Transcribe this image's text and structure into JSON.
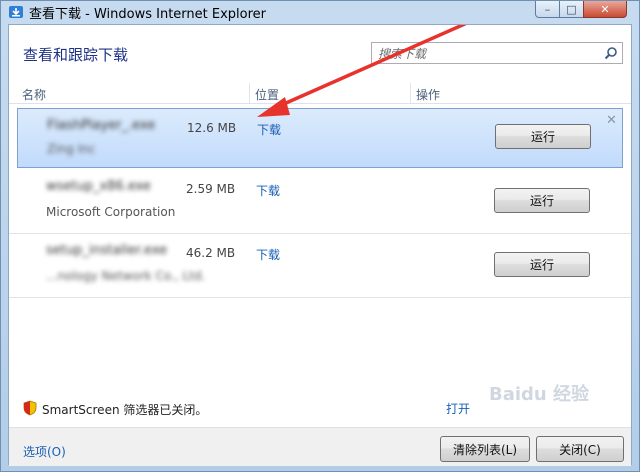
{
  "window": {
    "title": "查看下载 - Windows Internet Explorer"
  },
  "header": {
    "title": "查看和跟踪下载",
    "search_placeholder": "搜索下载"
  },
  "columns": {
    "name": "名称",
    "location": "位置",
    "actions": "操作"
  },
  "downloads": [
    {
      "name": "FlashPlayer_.exe",
      "publisher": "Zing Inc",
      "size": "12.6 MB",
      "location": "下载",
      "action": "运行",
      "selected": true
    },
    {
      "name": "wsetup_x86.exe",
      "publisher": "Microsoft Corporation",
      "size": "2.59 MB",
      "location": "下载",
      "action": "运行"
    },
    {
      "name": "setup_installer.exe",
      "publisher": "...nology Network Co., Ltd.",
      "size": "46.2 MB",
      "location": "下载",
      "action": "运行"
    }
  ],
  "status": {
    "smartscreen": "SmartScreen 筛选器已关闭。",
    "open_label": "打开"
  },
  "footer": {
    "options": "选项(O)",
    "clear_list": "清除列表(L)",
    "close": "关闭(C)"
  },
  "watermark": "Baidu 经验"
}
